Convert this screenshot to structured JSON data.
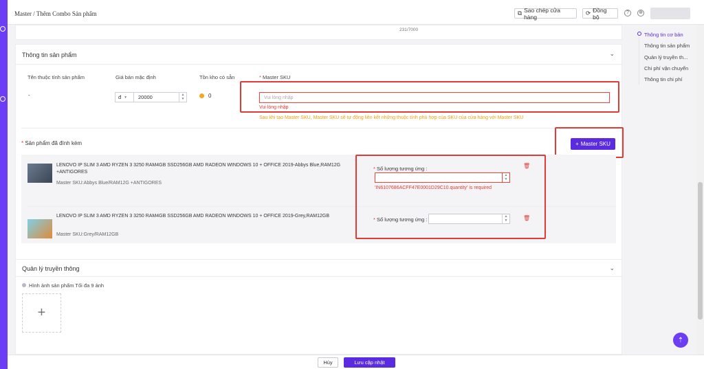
{
  "topbar": {
    "breadcrumb": "Master / Thêm Combo Sản phẩm",
    "copy_shop_label": "Sao chép cửa hàng",
    "sync_label": "Đồng bộ",
    "help_icon": "question-icon",
    "globe_icon": "globe-icon"
  },
  "desc_counter": "231/7000",
  "product_info": {
    "title": "Thông tin sản phẩm",
    "col_attr": "Tên thuộc tính sản phẩm",
    "col_price": "Giá bán mặc định",
    "col_stock": "Tồn kho có sẵn",
    "col_sku": "Master SKU",
    "row_attr": "-",
    "currency": "đ",
    "price_value": "20000",
    "stock_value": "0",
    "sku_placeholder": "Vui lòng nhập",
    "sku_error": "Vui lòng nhập",
    "sku_hint": "Sau khi tạo Master SKU,  Master SKU sẽ tự động liên kết những thuộc tính phù hợp của SKU của cửa hàng với Master SKU"
  },
  "attached": {
    "title": "Sản phẩm đã đính kèm",
    "add_button": "Master SKU",
    "qty_label": "Số lượng tương ứng :",
    "items": [
      {
        "name": "LENOVO IP SLIM 3 AMD RYZEN 3 3250 RAM4GB SSD256GB AMD RADEON WINDOWS 10 + OFFICE 2019-Abbys Blue,RAM12G +ANTIGORES",
        "sku": "Master SKU:Abbys Blue/RAM12G +ANTIGORES",
        "qty_error": "'IN6107686ACFF47E0001D29C10.quantity' is required"
      },
      {
        "name": "LENOVO IP SLIM 3 AMD RYZEN 3 3250 RAM4GB SSD256GB AMD RADEON WINDOWS 10 + OFFICE 2019-Grey,RAM12GB",
        "sku": "Master SKU:Grey/RAM12GB",
        "qty_error": ""
      }
    ]
  },
  "media": {
    "title": "Quản lý truyền thông",
    "hint": "Hình ảnh sản phẩm Tối đa 9 ảnh"
  },
  "right_nav": {
    "items": [
      "Thông tin cơ bản",
      "Thông tin sản phẩm",
      "Quản lý truyền th...",
      "Chi phí vận chuyển",
      "Thông tin chi phí"
    ]
  },
  "footer": {
    "cancel": "Hủy",
    "save": "Lưu cập nhật"
  },
  "colors": {
    "primary": "#5b2be0",
    "error": "#e53935",
    "warning": "#f59e0b"
  }
}
